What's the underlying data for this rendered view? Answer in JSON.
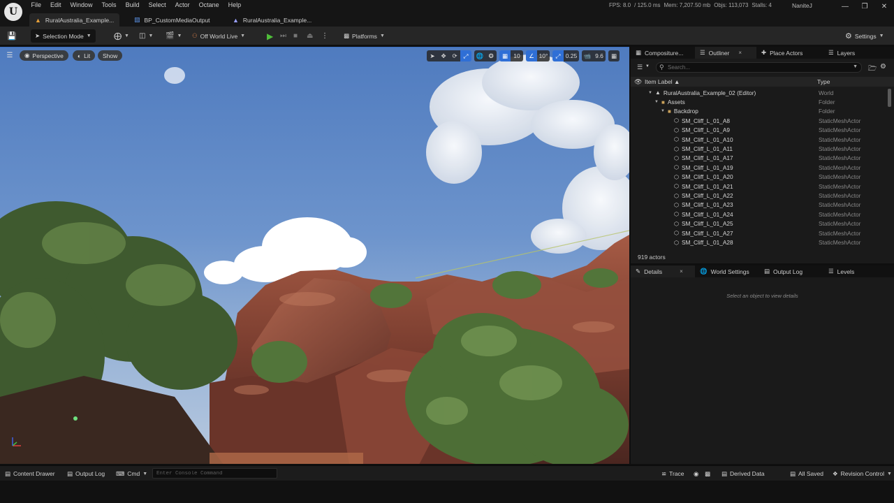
{
  "app": {
    "logo_glyph": "U",
    "menus": [
      "File",
      "Edit",
      "Window",
      "Tools",
      "Build",
      "Select",
      "Actor",
      "Octane",
      "Help"
    ],
    "stats": {
      "fps": "FPS: 8.0",
      "frame_ms": "/ 125.0 ms",
      "mem": "Mem: 7,207.50 mb",
      "objs": "Objs: 113,073",
      "stalls": "Stalls: 4"
    },
    "user": "NaniteJ"
  },
  "tabs": [
    {
      "label": "RuralAustralia_Example...",
      "icon": "level-icon",
      "active": true
    },
    {
      "label": "BP_CustomMediaOutput",
      "icon": "blueprint-icon",
      "active": false
    },
    {
      "label": "RuralAustralia_Example...",
      "icon": "level-icon",
      "active": false
    }
  ],
  "toolbar": {
    "mode_label": "Selection Mode",
    "play_mode_label": "Off World Live",
    "platforms_label": "Platforms",
    "settings_label": "Settings"
  },
  "viewport": {
    "perspective_label": "Perspective",
    "lit_label": "Lit",
    "show_label": "Show",
    "grid_snap": "10",
    "rotate_snap": "10°",
    "scale_snap": "0.25",
    "camera_speed": "9.6"
  },
  "outliner": {
    "tabs": [
      {
        "label": "Compositure...",
        "icon": "composure-icon"
      },
      {
        "label": "Outliner",
        "icon": "outliner-icon",
        "active": true,
        "close": "×"
      },
      {
        "label": "Place Actors",
        "icon": "place-actors-icon"
      },
      {
        "label": "Layers",
        "icon": "layers-icon"
      }
    ],
    "search_placeholder": "Search...",
    "col_label": "Item Label ▲",
    "col_type": "Type",
    "rows": [
      {
        "label": "RuralAustralia_Example_02 (Editor)",
        "type": "World",
        "depth": 0,
        "icon": "world-icon",
        "expand": "▼"
      },
      {
        "label": "Assets",
        "type": "Folder",
        "depth": 1,
        "icon": "folder-icon",
        "expand": "▼"
      },
      {
        "label": "Backdrop",
        "type": "Folder",
        "depth": 2,
        "icon": "folder-icon",
        "expand": "▼"
      },
      {
        "label": "SM_Cliff_L_01_A8",
        "type": "StaticMeshActor",
        "depth": 3,
        "icon": "mesh-icon",
        "expand": ""
      },
      {
        "label": "SM_Cliff_L_01_A9",
        "type": "StaticMeshActor",
        "depth": 3,
        "icon": "mesh-icon",
        "expand": ""
      },
      {
        "label": "SM_Cliff_L_01_A10",
        "type": "StaticMeshActor",
        "depth": 3,
        "icon": "mesh-icon",
        "expand": ""
      },
      {
        "label": "SM_Cliff_L_01_A11",
        "type": "StaticMeshActor",
        "depth": 3,
        "icon": "mesh-icon",
        "expand": ""
      },
      {
        "label": "SM_Cliff_L_01_A17",
        "type": "StaticMeshActor",
        "depth": 3,
        "icon": "mesh-icon",
        "expand": ""
      },
      {
        "label": "SM_Cliff_L_01_A19",
        "type": "StaticMeshActor",
        "depth": 3,
        "icon": "mesh-icon",
        "expand": ""
      },
      {
        "label": "SM_Cliff_L_01_A20",
        "type": "StaticMeshActor",
        "depth": 3,
        "icon": "mesh-icon",
        "expand": ""
      },
      {
        "label": "SM_Cliff_L_01_A21",
        "type": "StaticMeshActor",
        "depth": 3,
        "icon": "mesh-icon",
        "expand": ""
      },
      {
        "label": "SM_Cliff_L_01_A22",
        "type": "StaticMeshActor",
        "depth": 3,
        "icon": "mesh-icon",
        "expand": ""
      },
      {
        "label": "SM_Cliff_L_01_A23",
        "type": "StaticMeshActor",
        "depth": 3,
        "icon": "mesh-icon",
        "expand": ""
      },
      {
        "label": "SM_Cliff_L_01_A24",
        "type": "StaticMeshActor",
        "depth": 3,
        "icon": "mesh-icon",
        "expand": ""
      },
      {
        "label": "SM_Cliff_L_01_A25",
        "type": "StaticMeshActor",
        "depth": 3,
        "icon": "mesh-icon",
        "expand": ""
      },
      {
        "label": "SM_Cliff_L_01_A27",
        "type": "StaticMeshActor",
        "depth": 3,
        "icon": "mesh-icon",
        "expand": ""
      },
      {
        "label": "SM_Cliff_L_01_A28",
        "type": "StaticMeshActor",
        "depth": 3,
        "icon": "mesh-icon",
        "expand": ""
      }
    ],
    "actor_count": "919 actors"
  },
  "details": {
    "tabs": [
      {
        "label": "Details",
        "icon": "details-icon",
        "active": true,
        "close": "×"
      },
      {
        "label": "World Settings",
        "icon": "world-settings-icon"
      },
      {
        "label": "Output Log",
        "icon": "output-log-icon"
      },
      {
        "label": "Levels",
        "icon": "levels-icon"
      }
    ],
    "hint": "Select an object to view details"
  },
  "statusbar": {
    "content_drawer": "Content Drawer",
    "output_log": "Output Log",
    "cmd": "Cmd",
    "console_placeholder": "Enter Console Command",
    "trace": "Trace",
    "derived_data": "Derived Data",
    "all_saved": "All Saved",
    "revision_control": "Revision Control"
  },
  "colors": {
    "accent_blue": "#2f6fd6",
    "play_green": "#4fbf3a",
    "panel_bg": "#1a1a1a",
    "sky_top": "#4f79bd",
    "rock": "#8e4a3a"
  }
}
